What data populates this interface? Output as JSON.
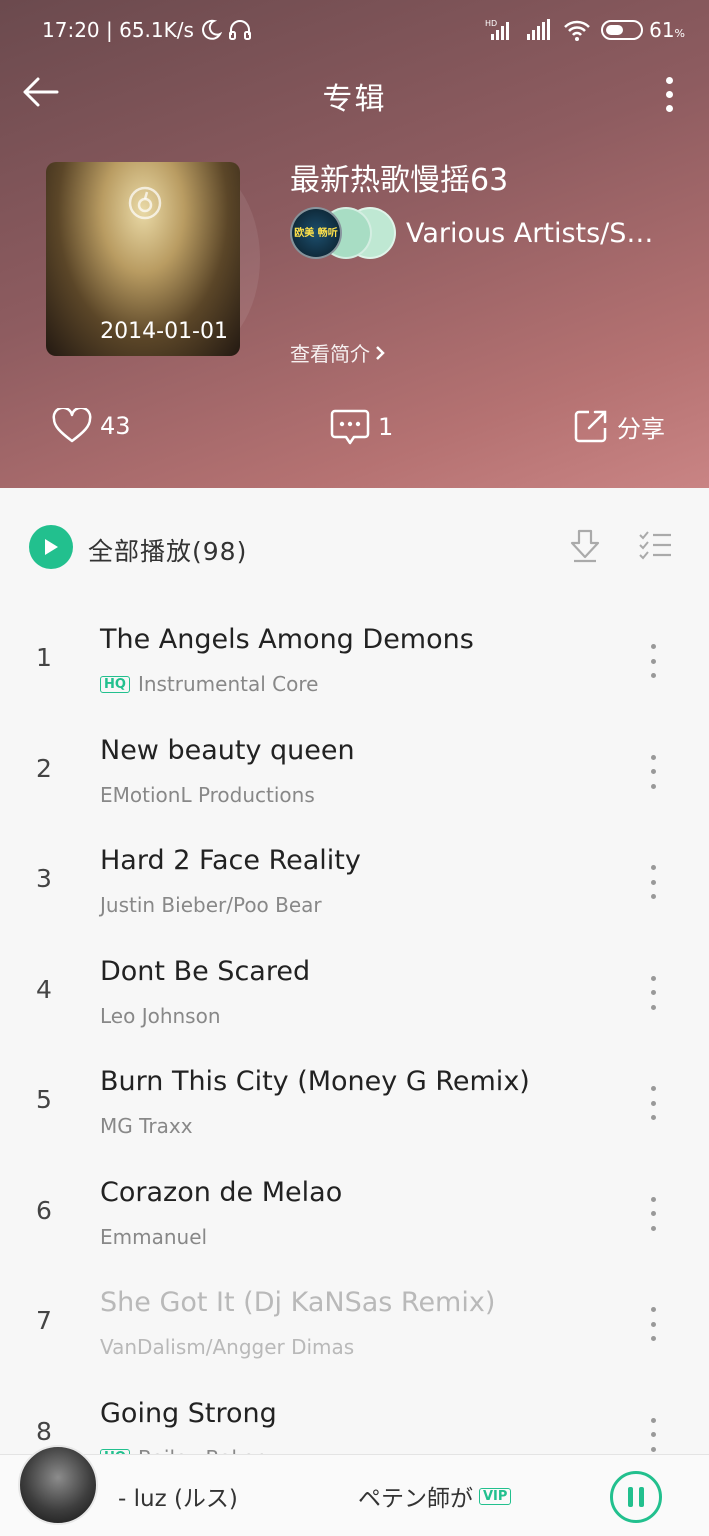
{
  "status_bar": {
    "time_speed": "17:20 | 65.1K/s",
    "battery": "61",
    "battery_unit": "%",
    "battery_level": 0.61,
    "icons": [
      "moon-icon",
      "headset-icon",
      "hd-signal-icon",
      "signal-icon",
      "wifi-icon",
      "battery-icon"
    ]
  },
  "topbar": {
    "title": "专辑"
  },
  "album": {
    "name": "最新热歌慢摇63",
    "date": "2014-01-01",
    "artists": "Various Artists/Sebastian",
    "artist_avatar_text": "欧美 畅听",
    "intro_link": "查看简介"
  },
  "actions": {
    "likes": "43",
    "comments": "1",
    "share": "分享"
  },
  "list": {
    "play_all": "全部播放(98)",
    "tracks": [
      {
        "num": "1",
        "title": "The Angels Among Demons",
        "artist": "Instrumental Core",
        "hq": "HQ"
      },
      {
        "num": "2",
        "title": "New beauty queen",
        "artist": "EMotionL Productions"
      },
      {
        "num": "3",
        "title": "Hard 2 Face Reality",
        "artist": "Justin Bieber/Poo Bear"
      },
      {
        "num": "4",
        "title": "Dont Be Scared",
        "artist": "Leo Johnson"
      },
      {
        "num": "5",
        "title": "Burn This City (Money G Remix)",
        "artist": "MG Traxx"
      },
      {
        "num": "6",
        "title": "Corazon de Melao",
        "artist": "Emmanuel"
      },
      {
        "num": "7",
        "title": "She Got It (Dj KaNSas Remix)",
        "artist": "VanDalism/Angger Dimas",
        "dimmed": true
      },
      {
        "num": "8",
        "title": "Going Strong",
        "artist": "Bailey Baker",
        "hq": "HQ"
      }
    ]
  },
  "player": {
    "text1": "- luz (ルス)",
    "text2": "ペテン師が",
    "vip": "VIP"
  },
  "colors": {
    "accent": "#22c08e",
    "header_start": "#6b4a4e",
    "header_end": "#c98484"
  }
}
